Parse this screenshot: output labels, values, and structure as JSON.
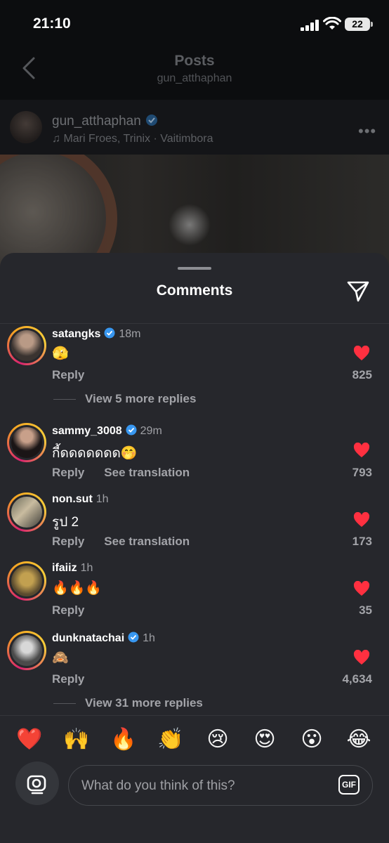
{
  "status_bar": {
    "time": "21:10",
    "battery": "22"
  },
  "header": {
    "title": "Posts",
    "subtitle": "gun_atthaphan"
  },
  "post": {
    "username": "gun_atthaphan",
    "music": "Mari Froes, Trinix · Vaitimbora",
    "more_icon": "more-horizontal-icon"
  },
  "comments_sheet": {
    "title": "Comments",
    "comments": [
      {
        "username": "satangks",
        "verified": true,
        "time": "18m",
        "text": "🫣",
        "reply": "Reply",
        "translate": "",
        "likes": "825",
        "view_replies": "View 5 more replies"
      },
      {
        "username": "sammy_3008",
        "verified": true,
        "time": "29m",
        "text": "กี้ดดดดดดด🤭",
        "reply": "Reply",
        "translate": "See translation",
        "likes": "793",
        "view_replies": ""
      },
      {
        "username": "non.sut",
        "verified": false,
        "time": "1h",
        "text": "รูป 2",
        "reply": "Reply",
        "translate": "See translation",
        "likes": "173",
        "view_replies": ""
      },
      {
        "username": "ifaiiz",
        "verified": false,
        "time": "1h",
        "text": "🔥🔥🔥",
        "reply": "Reply",
        "translate": "",
        "likes": "35",
        "view_replies": ""
      },
      {
        "username": "dunknatachai",
        "verified": true,
        "time": "1h",
        "text": "🙈",
        "reply": "Reply",
        "translate": "",
        "likes": "4,634",
        "view_replies": "View 31 more replies"
      }
    ],
    "reactions": [
      "❤️",
      "🙌",
      "🔥",
      "👏",
      "😢",
      "😍",
      "😮",
      "😂"
    ],
    "input_placeholder": "What do you think of this?",
    "gif_label": "GIF"
  },
  "colors": {
    "heart": "#ff3040",
    "verified": "#3897f0",
    "sheet_bg": "#26272c"
  }
}
